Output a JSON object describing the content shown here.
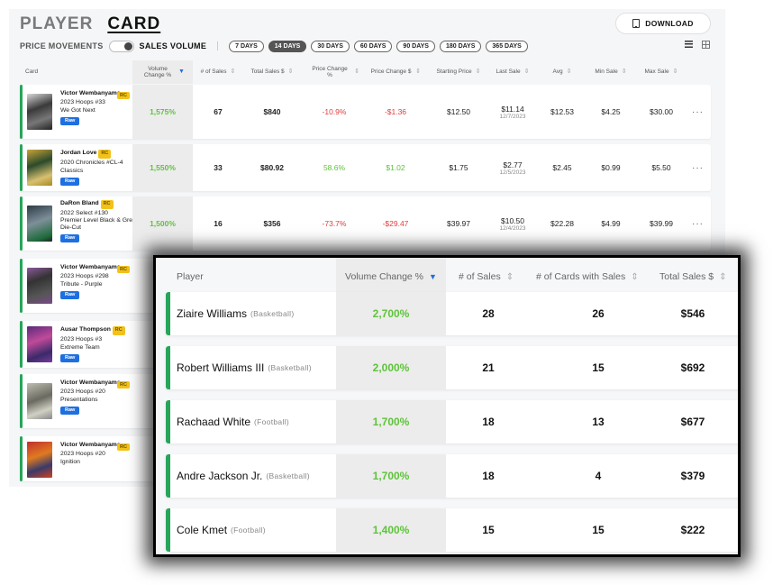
{
  "header": {
    "tabs": [
      {
        "label": "PLAYER",
        "active": false
      },
      {
        "label": "CARD",
        "active": true
      }
    ],
    "download_label": "DOWNLOAD"
  },
  "filters": {
    "mode_left": "PRICE MOVEMENTS",
    "mode_right": "SALES VOLUME",
    "mode_selected": "SALES VOLUME",
    "day_ranges": [
      "7 DAYS",
      "14 DAYS",
      "30 DAYS",
      "60 DAYS",
      "90 DAYS",
      "180 DAYS",
      "365 DAYS"
    ],
    "day_selected": "14 DAYS"
  },
  "card_table": {
    "columns": [
      "Card",
      "Volume Change %",
      "# of Sales",
      "Total Sales $",
      "Price Change %",
      "Price Change $",
      "Starting Price",
      "Last Sale",
      "Avg",
      "Min Sale",
      "Max Sale"
    ],
    "sorted_column": "Volume Change %",
    "rows": [
      {
        "player": "Victor Wembanyama",
        "card": "2023 Hoops #33",
        "variant": "We Got Next",
        "rc": "RC",
        "grade": "Raw",
        "volume_change": "1,575%",
        "sales": "67",
        "total_sales": "$840",
        "price_change_pct": "-10.9%",
        "price_change_usd": "-$1.36",
        "starting_price": "$12.50",
        "last_sale": "$11.14",
        "last_sale_date": "12/7/2023",
        "avg": "$12.53",
        "min_sale": "$4.25",
        "max_sale": "$30.00",
        "trend": "neg"
      },
      {
        "player": "Jordan Love",
        "card": "2020 Chronicles #CL-4",
        "variant": "Classics",
        "rc": "RC",
        "grade": "Raw",
        "volume_change": "1,550%",
        "sales": "33",
        "total_sales": "$80.92",
        "price_change_pct": "58.6%",
        "price_change_usd": "$1.02",
        "starting_price": "$1.75",
        "last_sale": "$2.77",
        "last_sale_date": "12/5/2023",
        "avg": "$2.45",
        "min_sale": "$0.99",
        "max_sale": "$5.50",
        "trend": "pos"
      },
      {
        "player": "DaRon Bland",
        "card": "2022 Select #130",
        "variant": "Premier Level Black & Green Die-Cut",
        "rc": "RC",
        "grade": "Raw",
        "volume_change": "1,500%",
        "sales": "16",
        "total_sales": "$356",
        "price_change_pct": "-73.7%",
        "price_change_usd": "-$29.47",
        "starting_price": "$39.97",
        "last_sale": "$10.50",
        "last_sale_date": "12/4/2023",
        "avg": "$22.28",
        "min_sale": "$4.99",
        "max_sale": "$39.99",
        "trend": "neg"
      },
      {
        "player": "Victor Wembanyama",
        "card": "2023 Hoops #298",
        "variant": "Tribute - Purple",
        "rc": "RC",
        "grade": "Raw"
      },
      {
        "player": "Ausar Thompson",
        "card": "2023 Hoops #3",
        "variant": "Extreme Team",
        "rc": "RC",
        "grade": "Raw"
      },
      {
        "player": "Victor Wembanyama",
        "card": "2023 Hoops #20",
        "variant": "Presentations",
        "rc": "RC",
        "grade": "Raw"
      },
      {
        "player": "Victor Wembanyama",
        "card": "2023 Hoops #20",
        "variant": "Ignition",
        "rc": "RC",
        "grade": ""
      }
    ],
    "more_label": "···"
  },
  "player_table": {
    "columns": [
      "Player",
      "Volume Change %",
      "# of Sales",
      "# of Cards with Sales",
      "Total Sales $"
    ],
    "sorted_column": "Volume Change %",
    "rows": [
      {
        "player": "Ziaire Williams",
        "sport": "(Basketball)",
        "volume_change": "2,700%",
        "sales": "28",
        "cards_with_sales": "26",
        "total_sales": "$546"
      },
      {
        "player": "Robert Williams III",
        "sport": "(Basketball)",
        "volume_change": "2,000%",
        "sales": "21",
        "cards_with_sales": "15",
        "total_sales": "$692"
      },
      {
        "player": "Rachaad White",
        "sport": "(Football)",
        "volume_change": "1,700%",
        "sales": "18",
        "cards_with_sales": "13",
        "total_sales": "$677"
      },
      {
        "player": "Andre Jackson Jr.",
        "sport": "(Basketball)",
        "volume_change": "1,700%",
        "sales": "18",
        "cards_with_sales": "4",
        "total_sales": "$379"
      },
      {
        "player": "Cole Kmet",
        "sport": "(Football)",
        "volume_change": "1,400%",
        "sales": "15",
        "cards_with_sales": "15",
        "total_sales": "$222"
      }
    ]
  },
  "colors": {
    "accent_green": "#27a55a",
    "positive": "#5ec43a",
    "negative": "#e03c3c",
    "rc_badge": "#f2c21b",
    "raw_badge": "#1e6fe0",
    "sort_active": "#1e6fe0"
  }
}
